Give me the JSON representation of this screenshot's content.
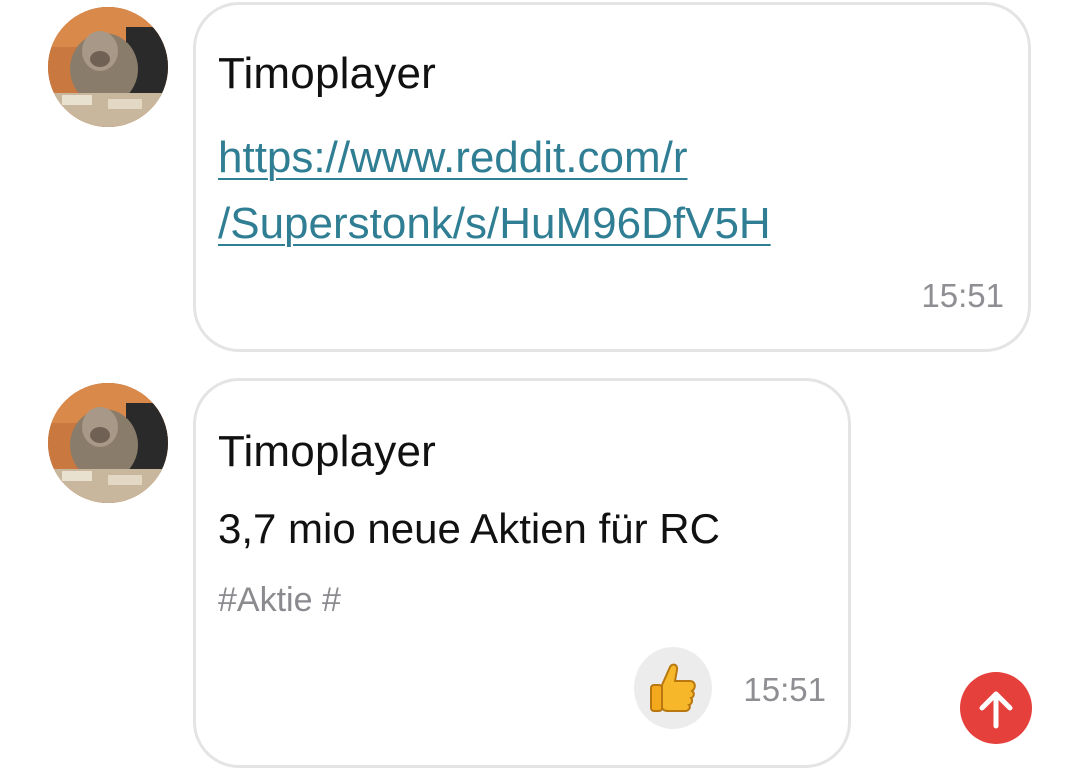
{
  "messages": [
    {
      "sender": "Timoplayer",
      "link_lines": [
        "https://www.reddit.com/r",
        "/Superstonk/s/HuM96DfV5H"
      ],
      "time": "15:51",
      "avatar": "baboon-avatar"
    },
    {
      "sender": "Timoplayer",
      "text": "3,7 mio neue Aktien für RC",
      "tags": "#Aktie #",
      "time": "15:51",
      "reaction": "thumbs-up-icon",
      "avatar": "baboon-avatar"
    }
  ],
  "scroll_button": {
    "icon": "arrow-up-icon",
    "color": "#e5403b"
  },
  "colors": {
    "link": "#2f7e93",
    "bubble_border": "#e4e4e6",
    "timestamp": "#8e8e93"
  }
}
